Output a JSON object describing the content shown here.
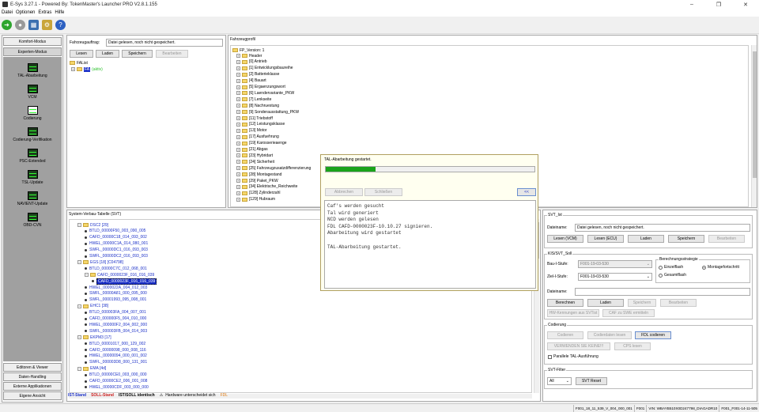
{
  "window": {
    "title": "E-Sys 3.27.1 - Powered By: TokenMaster's Launcher PRO V2.8.1.155"
  },
  "menu": [
    "Datei",
    "Optionen",
    "Extras",
    "Hilfe"
  ],
  "sidebar": {
    "top_buttons": [
      "Komfort-Modus",
      "Experten-Modus"
    ],
    "items": [
      "TAL-Abarbeitung",
      "VCM",
      "Codierung",
      "Codierung-Verifikation",
      "PSC-Extended",
      "TSL-Update",
      "NAVIENT-Update",
      "OBD-CVN"
    ],
    "bottom_buttons": [
      "Editoren & Viewer",
      "Daten-Handling",
      "Externe Applikationen",
      "Eigene Ansicht"
    ]
  },
  "fa_panel": {
    "label": "Fahrzeugauftrag:",
    "value": "Datei gelesen, noch nicht gespeichert.",
    "buttons": [
      "Lesen",
      "Laden",
      "Speichern",
      "Bearbeiten"
    ],
    "tree_root": "FAList",
    "tree_child_tag": "FA",
    "tree_child_status": "(aktiv)"
  },
  "fp_panel": {
    "title": "Fahrzeugprofil",
    "root": "FP_Version: 1",
    "items": [
      "Header",
      "[0] Antrieb",
      "[1] Entwicklungsbaureihe",
      "[2] Batterieklasse",
      "[4] Bauart",
      "[5] Ergaenzungswort",
      "[6] Laendervariante_PKW",
      "[7] Lenkseite",
      "[8] Nachruestung",
      "[9] Sonderausstattung_PKW",
      "[11] Triebstoff",
      "[12] Leistungsklasse",
      "[13] Motor",
      "[17] Ausfuehrung",
      "[19] Karosserieaenge",
      "[21] Abgas",
      "[23] Hybridart",
      "[24] Sicherheit",
      "[25] Fahrzeugzusatzdifferenzierung",
      "[28] Montagestand",
      "[29] Paket_PKW",
      "[34] Elektrische_Reichweite",
      "[128] Zylinderzahl",
      "[129] Hubraum"
    ]
  },
  "svt_panel": {
    "title": "System-Verbau-Tabelle (SVT)",
    "rows": [
      {
        "level": 0,
        "kind": "ecu",
        "text": "DSC2 [29]"
      },
      {
        "level": 1,
        "kind": "sw",
        "text": "BTLD_00000F50_003_090_005"
      },
      {
        "level": 1,
        "kind": "sw",
        "text": "CAFD_00000C18_014_093_002"
      },
      {
        "level": 1,
        "kind": "sw",
        "text": "HWEL_00000C1A_014_080_001"
      },
      {
        "level": 1,
        "kind": "sw",
        "text": "SWFL_00000DC1_016_093_003"
      },
      {
        "level": 1,
        "kind": "sw",
        "text": "SWFL_00000DC2_016_093_003"
      },
      {
        "level": 0,
        "kind": "ecu",
        "text": "EGS [18] [C04798]"
      },
      {
        "level": 1,
        "kind": "sw",
        "text": "BTLD_00000C7C_012_068_001"
      },
      {
        "level": 1,
        "kind": "grp",
        "text": "CAFD_0000023F_016_016_039"
      },
      {
        "level": 2,
        "kind": "sel",
        "text": "CAFD_0000023F_016_016_039"
      },
      {
        "level": 1,
        "kind": "sw",
        "text": "HWEL_0000022A_004_012_003"
      },
      {
        "level": 1,
        "kind": "sw",
        "text": "SWFL_00000A81_000_095_000"
      },
      {
        "level": 1,
        "kind": "sw",
        "text": "SWFL_00001993_095_008_001"
      },
      {
        "level": 0,
        "kind": "ecu",
        "text": "EHC1 [38]"
      },
      {
        "level": 1,
        "kind": "sw",
        "text": "BTLD_000003FA_004_007_001"
      },
      {
        "level": 1,
        "kind": "sw",
        "text": "CAFD_000000F5_004_010_000"
      },
      {
        "level": 1,
        "kind": "sw",
        "text": "HWEL_000000F2_004_002_000"
      },
      {
        "level": 1,
        "kind": "sw",
        "text": "SWFL_000003FB_004_014_003"
      },
      {
        "level": 0,
        "kind": "ecu",
        "text": "EKPM3 [17]"
      },
      {
        "level": 1,
        "kind": "sw",
        "text": "BTLD_00001017_000_129_002"
      },
      {
        "level": 1,
        "kind": "sw",
        "text": "CAFD_00000098_000_008_116"
      },
      {
        "level": 1,
        "kind": "sw",
        "text": "HWEL_00000094_000_001_002"
      },
      {
        "level": 1,
        "kind": "sw",
        "text": "SWFL_000003D8_000_131_001"
      },
      {
        "level": 0,
        "kind": "ecu",
        "text": "EMA [4d]"
      },
      {
        "level": 1,
        "kind": "sw",
        "text": "BTLD_00000CE0_003_000_000"
      },
      {
        "level": 1,
        "kind": "sw",
        "text": "CAFD_00000CE2_006_001_008"
      },
      {
        "level": 1,
        "kind": "sw",
        "text": "HWEL_00000CDF_003_000_000"
      }
    ]
  },
  "legend": {
    "ist": "IST-Stand",
    "soll": "SOLL-Stand",
    "same": "IST/SOLL identisch",
    "hw": "Hardware unterscheidet sich",
    "fdl": "FDL"
  },
  "tal_dialog": {
    "title": "TAL-Abarbeitung gestartet.",
    "progress_percent": 24,
    "buttons": [
      "Abbrechen",
      "Schließen"
    ],
    "collapse_label": "<<",
    "log_lines": [
      "Caf's werden gesucht",
      "Tal wird generiert",
      "NCD werden gelesen",
      "FDL CAFD-0000023F-10.10.27 signieren.",
      "Abarbeitung wird gestartet",
      "",
      "TAL-Abarbeitung gestartet."
    ]
  },
  "svt_ist": {
    "title": "SVT_Ist",
    "label": "Dateiname:",
    "value": "Datei gelesen, noch nicht gespeichert.",
    "buttons": [
      "Lesen (VCM)",
      "Lesen (ECU)",
      "Laden",
      "Speichern",
      "Bearbeiten"
    ]
  },
  "kis": {
    "title": "KIS/SVT_Soll",
    "bau_label": "Bau-I-Stufe:",
    "bau_value": "F001-19-03-530",
    "ziel_label": "Ziel-I-Stufe:",
    "ziel_value": "F001-19-03-530",
    "strategy_title": "Berechnungsstrategie",
    "strategies": [
      "Einzelflash",
      "Montagefortschritt",
      "Gesamtflash"
    ],
    "dateiname_label": "Dateiname:",
    "buttons": [
      "Berechnen",
      "Laden",
      "Speichern",
      "Bearbeiten"
    ],
    "hw_button": "HW-Kennungen aus SVTist",
    "caf_button": "CAF zu SWE ermitteln"
  },
  "codierung": {
    "title": "Codierung",
    "buttons": [
      "Codieren",
      "Codierdaten lesen",
      "FDL codieren"
    ],
    "verwenden": "VERWENDEN SIE KEINE!!!",
    "cps": "CPS lesen",
    "checkbox": "Parallele TAL-Ausführung"
  },
  "svt_filter": {
    "title": "SVT-Filter",
    "value": "All",
    "reset": "SVT Reset"
  },
  "statusbar": [
    "F001_18_11_539_V_004_000_001",
    "F001",
    "VIN: WBAYB510X0D247798_DIAGADR10",
    "F001_F001-14-11-505"
  ],
  "colors": {
    "accent_blue": "#1c31c8",
    "soll_red": "#cc2222",
    "fdl_orange": "#e07a10",
    "progress_green": "#1aa31a"
  }
}
